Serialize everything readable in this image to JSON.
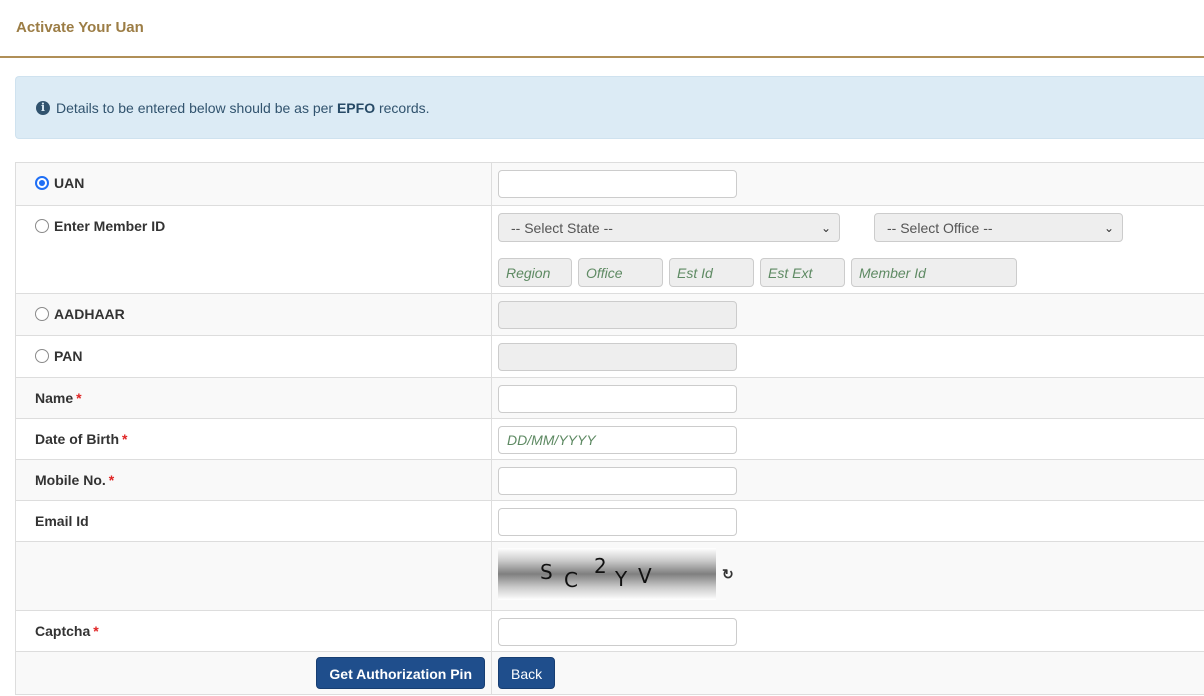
{
  "page": {
    "title": "Activate Your Uan"
  },
  "alert": {
    "icon": "info-circle-icon",
    "text_before": "Details to be entered below should be as per",
    "text_bold": "EPFO",
    "text_after": "records."
  },
  "form": {
    "uan": {
      "label": "UAN",
      "selected": true,
      "value": ""
    },
    "member_id": {
      "label": "Enter Member ID",
      "selected": false,
      "state_select": "-- Select State --",
      "office_select": "-- Select Office --",
      "placeholders": {
        "region": "Region",
        "office": "Office",
        "est_id": "Est Id",
        "est_ext": "Est Ext",
        "member_id": "Member Id"
      }
    },
    "aadhaar": {
      "label": "AADHAAR",
      "selected": false,
      "value": ""
    },
    "pan": {
      "label": "PAN",
      "selected": false,
      "value": ""
    },
    "name": {
      "label": "Name",
      "required": "*",
      "value": ""
    },
    "dob": {
      "label": "Date of Birth",
      "required": "*",
      "placeholder": "DD/MM/YYYY"
    },
    "mobile": {
      "label": "Mobile No.",
      "required": "*",
      "value": ""
    },
    "email": {
      "label": "Email Id",
      "value": ""
    },
    "captcha_image": {
      "chars": [
        "S",
        "C",
        "2",
        "Y",
        "V"
      ],
      "refresh_icon": "refresh-icon"
    },
    "captcha": {
      "label": "Captcha",
      "required": "*",
      "value": ""
    }
  },
  "buttons": {
    "get_pin": "Get Authorization Pin",
    "back": "Back"
  },
  "colors": {
    "title": "#9c7d45",
    "alert_bg": "#dcebf5",
    "button": "#1f4e8c",
    "required": "#e02424",
    "placeholder": "#5e8a63"
  }
}
